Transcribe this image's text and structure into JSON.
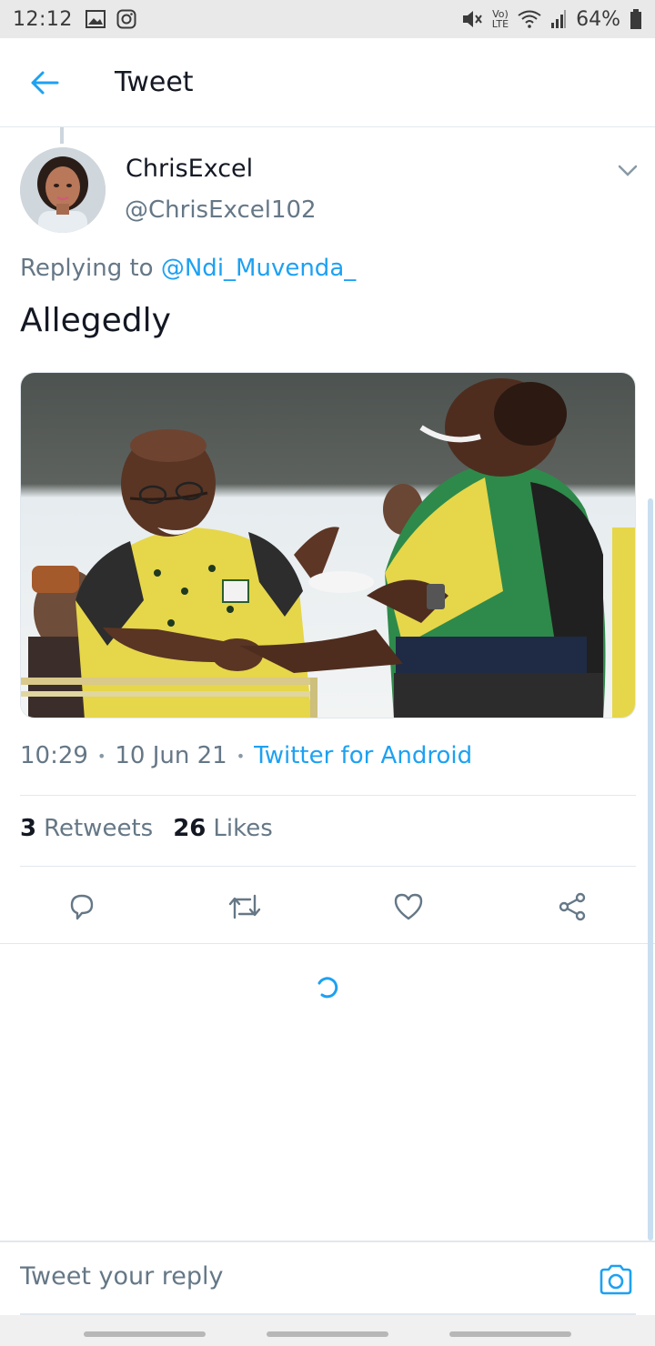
{
  "status_bar": {
    "time": "12:12",
    "battery": "64%",
    "network": "LTE",
    "icons": [
      "gallery-icon",
      "instagram-icon",
      "mute-icon",
      "volte-icon",
      "wifi-icon",
      "signal-icon",
      "battery-icon"
    ]
  },
  "app_bar": {
    "title": "Tweet",
    "back_icon": "arrow-left-icon"
  },
  "tweet": {
    "author_name": "ChrisExcel",
    "author_handle": "@ChrisExcel102",
    "replying_prefix": "Replying to",
    "replying_to": "@Ndi_Muvenda_",
    "text": "Allegedly",
    "time": "10:29",
    "date": "10 Jun 21",
    "client": "Twitter for Android",
    "retweets_count": "3",
    "retweets_label": "Retweets",
    "likes_count": "26",
    "likes_label": "Likes"
  },
  "actions": [
    "reply-icon",
    "retweet-icon",
    "like-icon",
    "share-icon"
  ],
  "reply_bar": {
    "placeholder": "Tweet your reply"
  },
  "colors": {
    "accent": "#1da1f2",
    "secondary_text": "#657786",
    "primary_text": "#141823",
    "divider": "#e1e8ed"
  }
}
